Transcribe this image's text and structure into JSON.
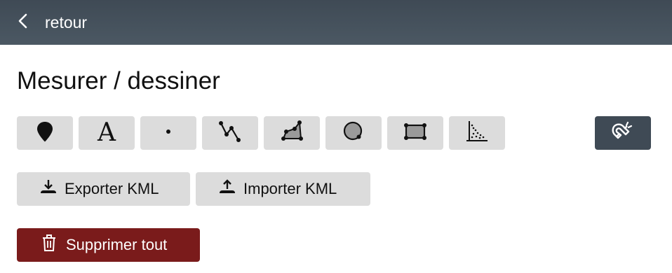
{
  "header": {
    "back_label": "retour",
    "back_icon": "chevron-left-icon"
  },
  "page": {
    "title": "Mesurer / dessiner"
  },
  "tools": [
    {
      "name": "marker",
      "icon": "map-marker-icon"
    },
    {
      "name": "text",
      "icon": "text-a-icon",
      "glyph": "A"
    },
    {
      "name": "point",
      "icon": "dot-icon"
    },
    {
      "name": "line",
      "icon": "polyline-icon"
    },
    {
      "name": "polygon",
      "icon": "polygon-icon"
    },
    {
      "name": "circle",
      "icon": "circle-icon"
    },
    {
      "name": "rectangle",
      "icon": "rectangle-icon"
    },
    {
      "name": "profile",
      "icon": "elevation-profile-icon"
    }
  ],
  "snap_tool": {
    "icon": "magnet-snap-icon"
  },
  "kml": {
    "export_label": "Exporter KML",
    "export_icon": "download-icon",
    "import_label": "Importer KML",
    "import_icon": "upload-icon"
  },
  "delete_all": {
    "label": "Supprimer tout",
    "icon": "trash-icon"
  },
  "colors": {
    "header_bg": "#46525d",
    "tool_bg": "#dcdcdc",
    "snap_bg": "#3f4a55",
    "danger_bg": "#7a1b1b"
  }
}
